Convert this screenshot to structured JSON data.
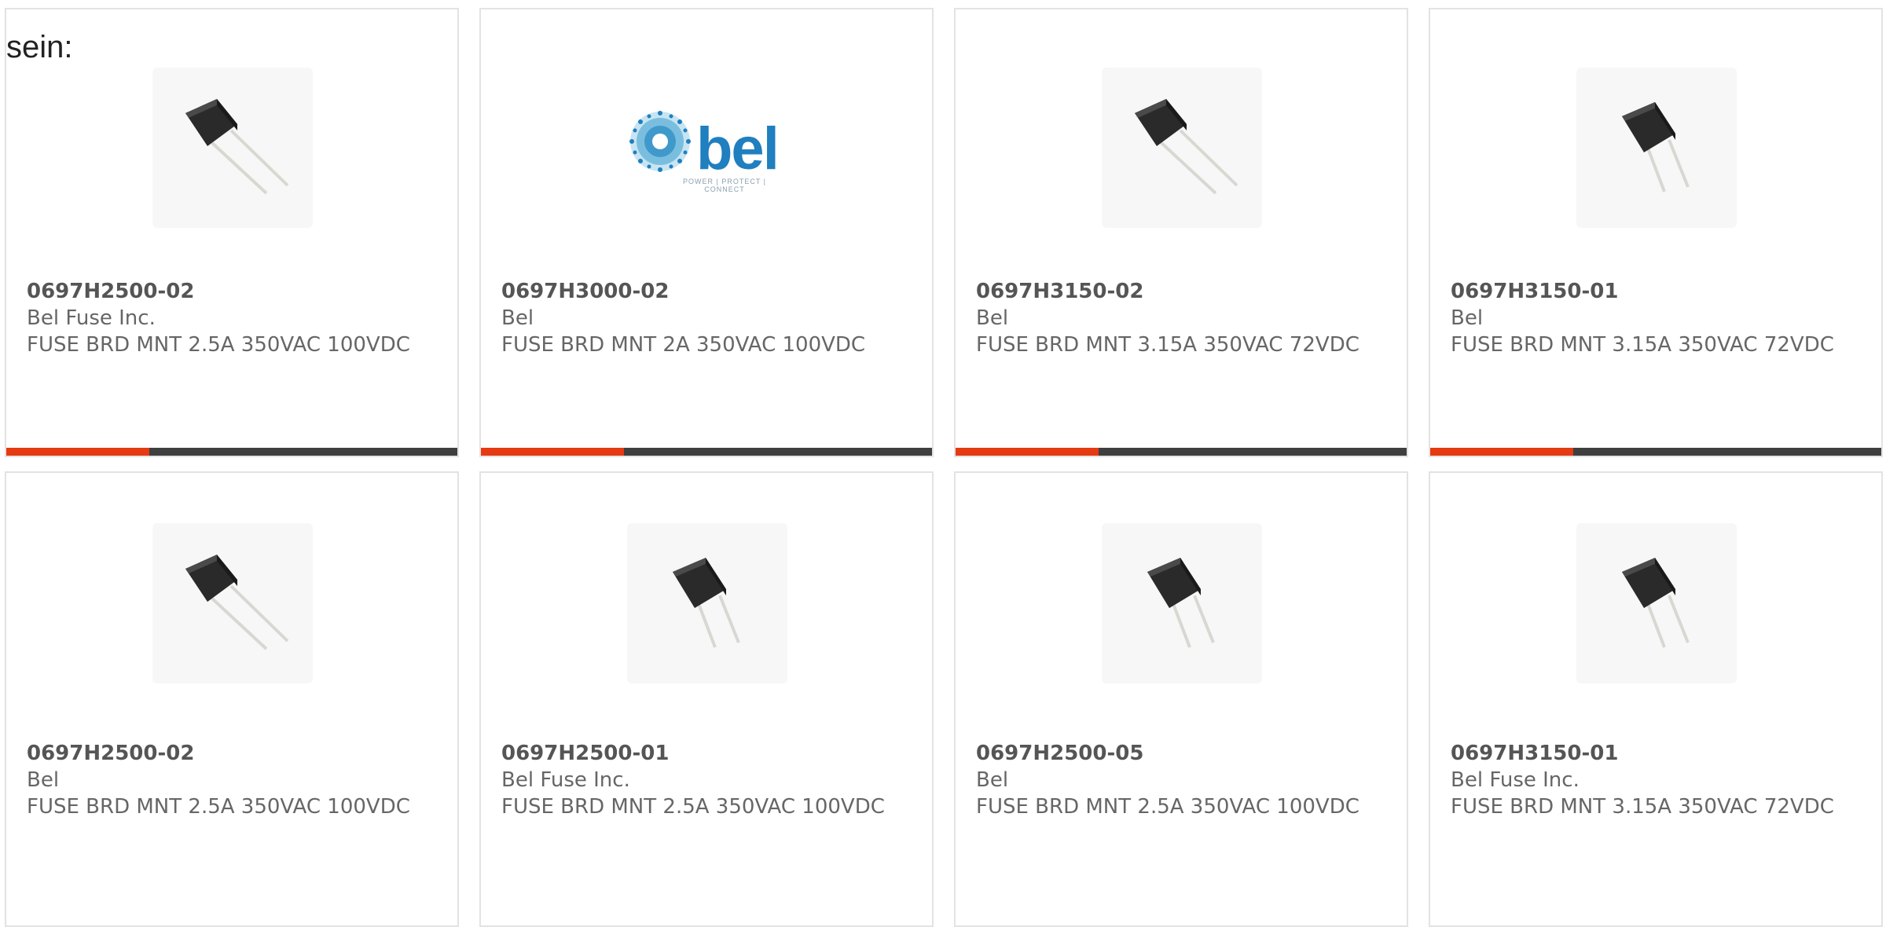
{
  "intro": {
    "text": "sein:"
  },
  "products": [
    {
      "part_number": "0697H2500-02",
      "manufacturer": "Bel Fuse Inc.",
      "description": "FUSE BRD MNT 2.5A 350VAC 100VDC",
      "image": "fuse-angled-image"
    },
    {
      "part_number": "0697H3000-02",
      "manufacturer": "Bel",
      "description": "FUSE BRD MNT 2A 350VAC 100VDC",
      "image": "bel-logo",
      "logo": {
        "wordmark": "bel",
        "tagline": "POWER | PROTECT | CONNECT"
      }
    },
    {
      "part_number": "0697H3150-02",
      "manufacturer": "Bel",
      "description": "FUSE BRD MNT 3.15A 350VAC 72VDC",
      "image": "fuse-angled-image"
    },
    {
      "part_number": "0697H3150-01",
      "manufacturer": "Bel",
      "description": "FUSE BRD MNT 3.15A 350VAC 72VDC",
      "image": "fuse-upright-image"
    },
    {
      "part_number": "0697H2500-02",
      "manufacturer": "Bel",
      "description": "FUSE BRD MNT 2.5A 350VAC 100VDC",
      "image": "fuse-angled-image"
    },
    {
      "part_number": "0697H2500-01",
      "manufacturer": "Bel Fuse Inc.",
      "description": "FUSE BRD MNT 2.5A 350VAC 100VDC",
      "image": "fuse-upright-image"
    },
    {
      "part_number": "0697H2500-05",
      "manufacturer": "Bel",
      "description": "FUSE BRD MNT 2.5A 350VAC 100VDC",
      "image": "fuse-upright-image"
    },
    {
      "part_number": "0697H3150-01",
      "manufacturer": "Bel Fuse Inc.",
      "description": "FUSE BRD MNT 3.15A 350VAC 72VDC",
      "image": "fuse-upright-image"
    }
  ],
  "colors": {
    "accent": "#e63a12",
    "bar": "#3f3f3f",
    "text": "#666666",
    "logo": "#1f7fbf"
  }
}
